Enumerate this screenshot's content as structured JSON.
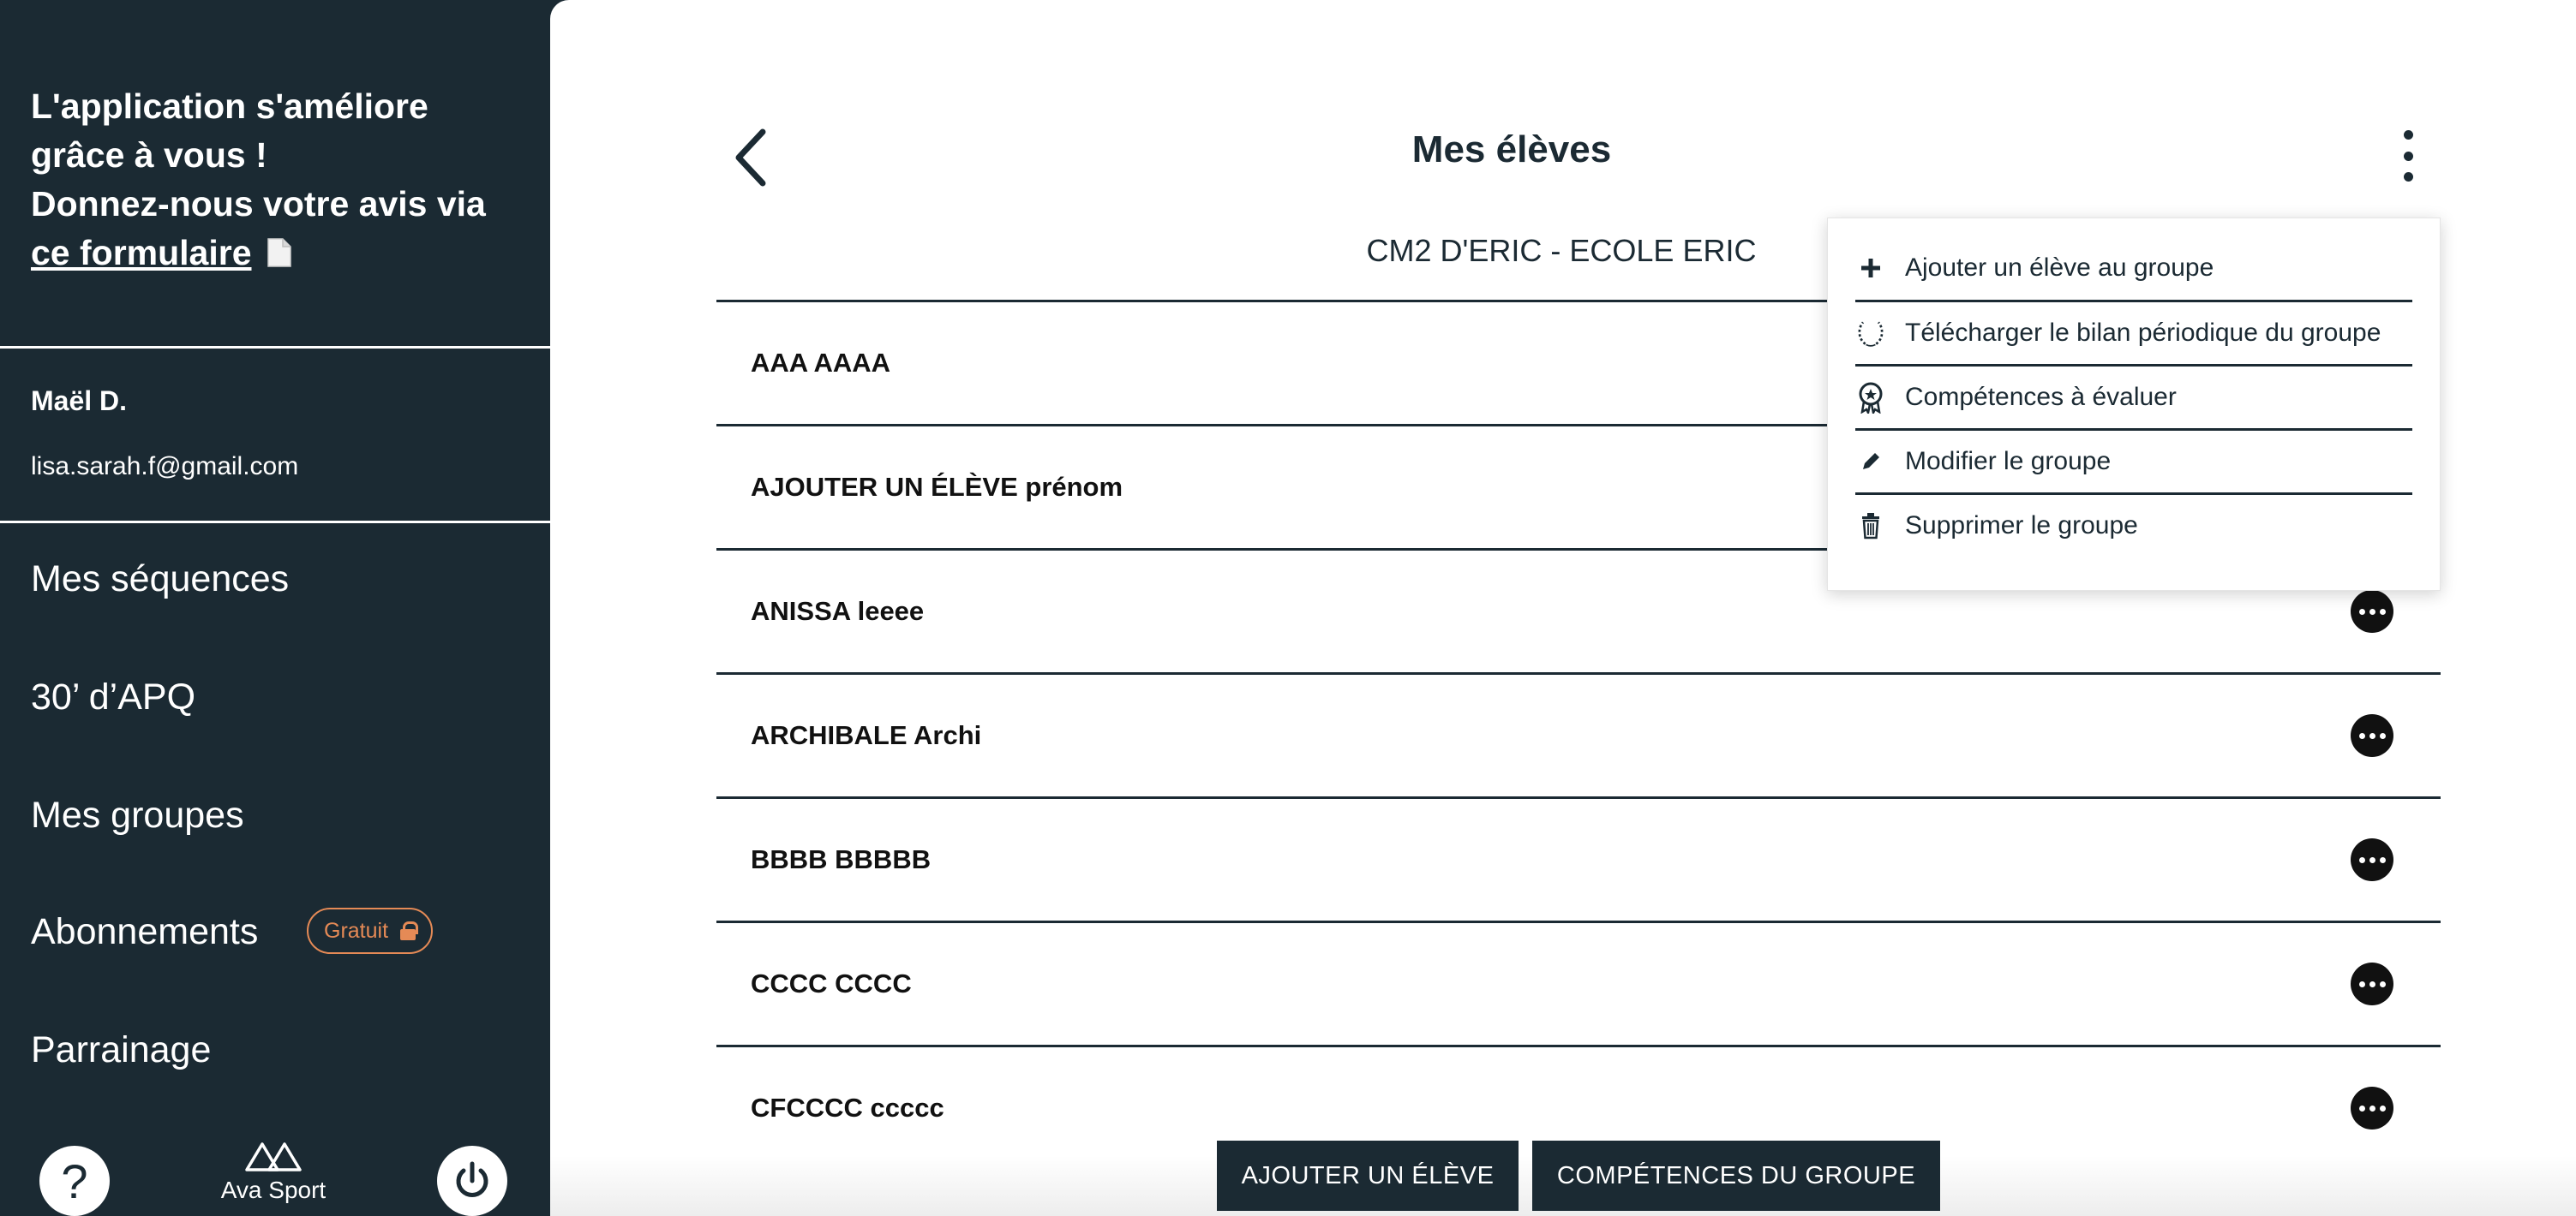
{
  "sidebar": {
    "feedback": {
      "line1": "L'application s'améliore",
      "line2": "grâce à vous !",
      "line3": "Donnez-nous votre avis via",
      "link": "ce formulaire",
      "link_icon": "document-icon"
    },
    "user": {
      "name": "Maël D.",
      "email": "lisa.sarah.f@gmail.com"
    },
    "nav": [
      {
        "label": "Mes séquences"
      },
      {
        "label": "30’ d’APQ"
      },
      {
        "label": "Mes groupes"
      },
      {
        "label": "Abonnements",
        "badge": "Gratuit"
      },
      {
        "label": "Parrainage"
      }
    ],
    "footer": {
      "help": "?",
      "brand": "Ava Sport"
    },
    "colors": {
      "background": "#1b2a33",
      "badge": "#e58a56"
    }
  },
  "main": {
    "title": "Mes élèves",
    "group_name": "CM2 D'ERIC - ECOLE ERIC",
    "students": [
      {
        "name": "AAA AAAA"
      },
      {
        "name": "AJOUTER UN ÉLÈVE prénom"
      },
      {
        "name": "ANISSA leeee"
      },
      {
        "name": "ARCHIBALE Archi"
      },
      {
        "name": "BBBB BBBBB"
      },
      {
        "name": "CCCC CCCC"
      },
      {
        "name": "CFCCCC ccccc"
      }
    ],
    "menu": [
      {
        "label": "Ajouter un élève au groupe",
        "icon": "plus-icon"
      },
      {
        "label": "Télécharger le bilan périodique du groupe",
        "icon": "laurel-icon"
      },
      {
        "label": "Compétences à évaluer",
        "icon": "award-icon"
      },
      {
        "label": "Modifier le groupe",
        "icon": "pencil-icon"
      },
      {
        "label": "Supprimer le groupe",
        "icon": "trash-icon"
      }
    ],
    "buttons": {
      "add_student": "AJOUTER UN ÉLÈVE",
      "group_skills": "COMPÉTENCES DU GROUPE"
    }
  }
}
